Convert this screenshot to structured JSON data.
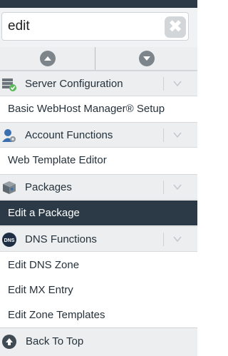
{
  "search": {
    "value": "edit",
    "clear_glyph": "✖"
  },
  "collapse_controls": {
    "up_icon": "arrow-up-icon",
    "down_icon": "arrow-down-icon"
  },
  "sections": [
    {
      "label": "Server Configuration",
      "icon": "server-config-icon"
    },
    {
      "label": "Account Functions",
      "icon": "account-user-icon"
    },
    {
      "label": "Packages",
      "icon": "package-box-icon"
    },
    {
      "label": "DNS Functions",
      "icon": "dns-badge-icon",
      "icon_text": "DNS"
    }
  ],
  "items": {
    "server_configuration": [
      "Basic WebHost Manager® Setup"
    ],
    "account_functions": [
      "Web Template Editor"
    ],
    "packages": [
      "Edit a Package"
    ],
    "dns_functions": [
      "Edit DNS Zone",
      "Edit MX Entry",
      "Edit Zone Templates"
    ]
  },
  "active_item": "Edit a Package",
  "footer": {
    "label": "Back To Top",
    "icon": "arrow-up-circle-icon"
  },
  "colors": {
    "topbar": "#2b3a46",
    "active_bg": "#2b3a46",
    "section_bg": "#eceeef",
    "accent_green": "#5cb85c",
    "accent_blue": "#3a6fb0"
  }
}
